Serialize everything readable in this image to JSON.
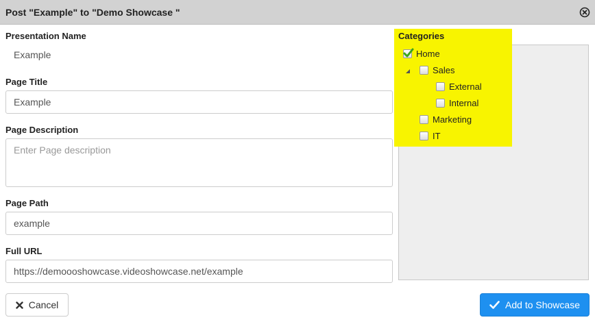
{
  "dialog": {
    "title": "Post \"Example\" to \"Demo Showcase \"",
    "close_icon": "close-circle-icon"
  },
  "form": {
    "presentation_name": {
      "label": "Presentation Name",
      "value": "Example"
    },
    "page_title": {
      "label": "Page Title",
      "value": "Example",
      "placeholder": ""
    },
    "page_description": {
      "label": "Page Description",
      "value": "",
      "placeholder": "Enter Page description"
    },
    "page_path": {
      "label": "Page Path",
      "value": "example"
    },
    "full_url": {
      "label": "Full URL",
      "value": "https://demoooshowcase.videoshowcase.net/example"
    }
  },
  "categories": {
    "label": "Categories",
    "highlight_color": "#f8f400",
    "nodes": [
      {
        "label": "Home",
        "checked": true
      },
      {
        "label": "Sales",
        "checked": false,
        "expanded": true
      },
      {
        "label": "External",
        "checked": false
      },
      {
        "label": "Internal",
        "checked": false
      },
      {
        "label": "Marketing",
        "checked": false
      },
      {
        "label": "IT",
        "checked": false
      }
    ]
  },
  "actions": {
    "cancel_label": "Cancel",
    "cancel_icon": "x-icon",
    "add_label": "Add to Showcase",
    "add_icon": "checkmark-icon",
    "add_color": "#1e90f0"
  }
}
